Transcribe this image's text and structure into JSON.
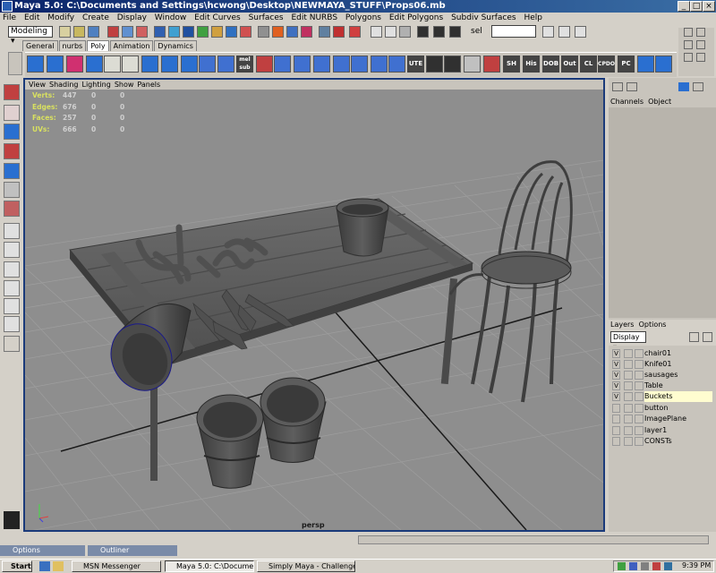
{
  "window": {
    "title": "Maya 5.0: C:\\Documents and Settings\\hcwong\\Desktop\\NEWMAYA_STUFF\\Props06.mb"
  },
  "menubar": [
    "File",
    "Edit",
    "Modify",
    "Create",
    "Display",
    "Window",
    "Edit Curves",
    "Surfaces",
    "Edit NURBS",
    "Polygons",
    "Edit Polygons",
    "Subdiv Surfaces",
    "Help"
  ],
  "statusline": {
    "mode": "Modeling",
    "sel_label": "sel"
  },
  "shelf": {
    "tabs": [
      "General",
      "nurbs",
      "Poly",
      "Animation",
      "Dynamics"
    ],
    "active_tab": "Poly",
    "text_icons": [
      "mel sub",
      "UTE",
      "SH",
      "His",
      "DOB",
      "Out",
      "CL",
      "CPDO",
      "PC"
    ]
  },
  "panel_menu": [
    "View",
    "Shading",
    "Lighting",
    "Show",
    "Panels"
  ],
  "stats": [
    {
      "k": "Verts:",
      "a": "447",
      "b": "0",
      "c": "0"
    },
    {
      "k": "Edges:",
      "a": "676",
      "b": "0",
      "c": "0"
    },
    {
      "k": "Faces:",
      "a": "257",
      "b": "0",
      "c": "0"
    },
    {
      "k": "UVs:",
      "a": "666",
      "b": "0",
      "c": "0"
    }
  ],
  "viewport": {
    "camera": "persp"
  },
  "channel_box": {
    "tabs": [
      "Channels",
      "Object"
    ]
  },
  "layers": {
    "header": [
      "Layers",
      "Options"
    ],
    "display": "Display",
    "items": [
      {
        "v": "V",
        "name": "chair01"
      },
      {
        "v": "V",
        "name": "Knife01"
      },
      {
        "v": "V",
        "name": "sausages"
      },
      {
        "v": "V",
        "name": "Table"
      },
      {
        "v": "V",
        "name": "Buckets"
      },
      {
        "v": "",
        "name": "button"
      },
      {
        "v": "",
        "name": "ImagePlane"
      },
      {
        "v": "",
        "name": "layer1"
      },
      {
        "v": "",
        "name": "CONSTs"
      }
    ],
    "selected": "Buckets"
  },
  "minimized": [
    "Options",
    "Outliner"
  ],
  "taskbar": {
    "start": "Start",
    "items": [
      "MSN Messenger",
      "Maya 5.0: C:\\Documen...",
      "Simply Maya - Challenge ..."
    ],
    "clock": "9:39 PM"
  }
}
